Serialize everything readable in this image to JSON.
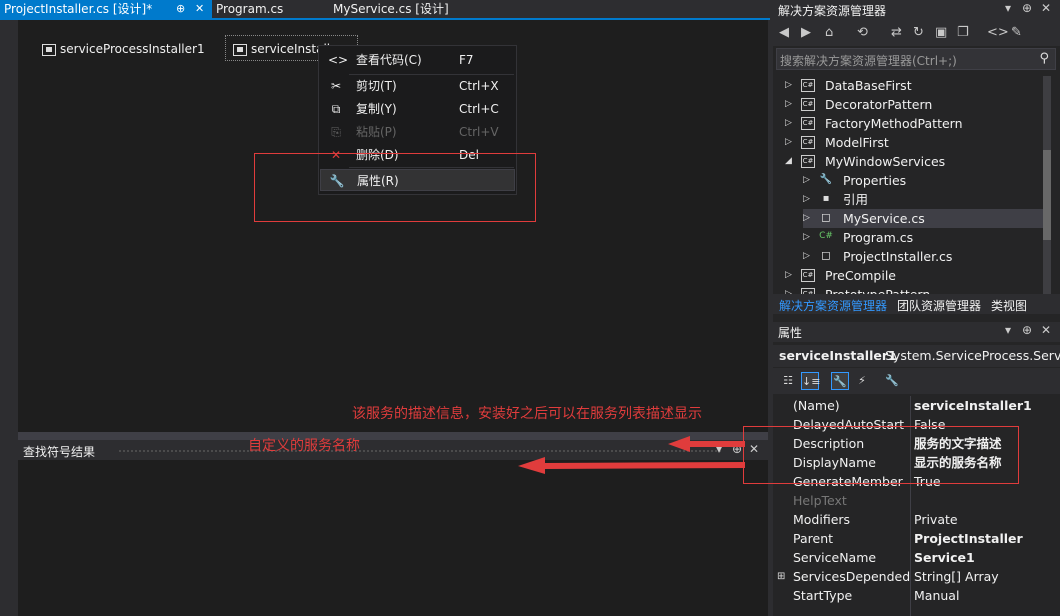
{
  "tabs": [
    {
      "label": "ProjectInstaller.cs [设计]*",
      "pin": "⊕",
      "close": "✕"
    },
    {
      "label": "Program.cs"
    },
    {
      "label": "MyService.cs [设计]"
    }
  ],
  "designer": {
    "components": [
      "serviceProcessInstaller1",
      "serviceInstall"
    ]
  },
  "context_menu": {
    "items": [
      {
        "icon": "<>",
        "label": "查看代码(C)",
        "shortcut": "F7"
      },
      {
        "icon": "✂",
        "label": "剪切(T)",
        "shortcut": "Ctrl+X"
      },
      {
        "icon": "⧉",
        "label": "复制(Y)",
        "shortcut": "Ctrl+C"
      },
      {
        "icon": "⎘",
        "label": "粘贴(P)",
        "shortcut": "Ctrl+V"
      },
      {
        "icon": "✕",
        "label": "删除(D)",
        "shortcut": "Del"
      },
      {
        "icon": "🔧",
        "label": "属性(R)",
        "shortcut": ""
      }
    ]
  },
  "find_panel": {
    "title": "查找符号结果",
    "dropdown": "▾",
    "pin": "⊕",
    "close": "✕"
  },
  "annotations": {
    "description_note": "该服务的描述信息，安装好之后可以在服务列表描述显示",
    "name_note": "自定义的服务名称"
  },
  "solution_explorer": {
    "title": "解决方案资源管理器",
    "title_buttons": [
      "▾",
      "⊕",
      "✕"
    ],
    "search_placeholder": "搜索解决方案资源管理器(Ctrl+;)",
    "search_icon": "⚲",
    "tree": [
      {
        "label": "DataBaseFirst",
        "icon": "C#",
        "arrow": "▷"
      },
      {
        "label": "DecoratorPattern",
        "icon": "C#",
        "arrow": "▷"
      },
      {
        "label": "FactoryMethodPattern",
        "icon": "C#",
        "arrow": "▷"
      },
      {
        "label": "ModelFirst",
        "icon": "C#",
        "arrow": "▷"
      },
      {
        "label": "MyWindowServices",
        "icon": "C#",
        "arrow": "◢"
      },
      {
        "label": "Properties",
        "icon": "🔧",
        "arrow": "▷"
      },
      {
        "label": "引用",
        "icon": "▪",
        "arrow": "▷"
      },
      {
        "label": "MyService.cs",
        "icon": "◻",
        "arrow": "▷"
      },
      {
        "label": "Program.cs",
        "icon": "C#",
        "arrow": "▷"
      },
      {
        "label": "ProjectInstaller.cs",
        "icon": "◻",
        "arrow": "▷"
      },
      {
        "label": "PreCompile",
        "icon": "C#",
        "arrow": "▷"
      },
      {
        "label": "PrototypePattern",
        "icon": "C#",
        "arrow": "▷"
      }
    ],
    "bottom_tabs": [
      "解决方案资源管理器",
      "团队资源管理器",
      "类视图"
    ]
  },
  "properties": {
    "title": "属性",
    "title_buttons": [
      "▾",
      "⊕",
      "✕"
    ],
    "object_name": "serviceInstaller1",
    "object_type": "System.ServiceProcess.Serv",
    "rows": [
      {
        "name": "(Name)",
        "value": "serviceInstaller1",
        "bold": true
      },
      {
        "name": "DelayedAutoStart",
        "value": "False",
        "bold": false
      },
      {
        "name": "Description",
        "value": "服务的文字描述",
        "bold": true
      },
      {
        "name": "DisplayName",
        "value": "显示的服务名称",
        "bold": true
      },
      {
        "name": "GenerateMember",
        "value": "True",
        "bold": false
      },
      {
        "name": "HelpText",
        "value": "",
        "bold": false
      },
      {
        "name": "Modifiers",
        "value": "Private",
        "bold": false
      },
      {
        "name": "Parent",
        "value": "ProjectInstaller",
        "bold": true
      },
      {
        "name": "ServiceName",
        "value": "Service1",
        "bold": true
      },
      {
        "name": "ServicesDependedO",
        "value": "String[] Array",
        "bold": false
      },
      {
        "name": "StartType",
        "value": "Manual",
        "bold": false
      }
    ]
  },
  "colors": {
    "accent": "#007acc",
    "annotation": "#e03c3c",
    "background": "#2d2d30"
  }
}
